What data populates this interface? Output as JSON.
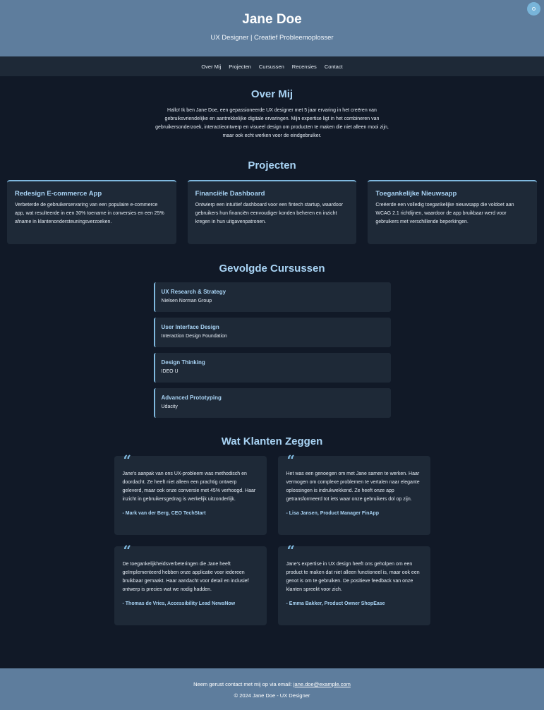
{
  "header": {
    "name": "Jane Doe",
    "tagline": "UX Designer | Creatief Probleemoplosser"
  },
  "nav": {
    "items": [
      "Over Mij",
      "Projecten",
      "Cursussen",
      "Recensies",
      "Contact"
    ]
  },
  "about": {
    "title": "Over Mij",
    "text": "Hallo! Ik ben Jane Doe, een gepassioneerde UX designer met 5 jaar ervaring in het creëren van gebruiksvriendelijke en aantrekkelijke digitale ervaringen. Mijn expertise ligt in het combineren van gebruikersonderzoek, interactieontwerp en visueel design om producten te maken die niet alleen mooi zijn, maar ook echt werken voor de eindgebruiker."
  },
  "projects": {
    "title": "Projecten",
    "items": [
      {
        "title": "Redesign E-commerce App",
        "text": "Verbeterde de gebruikerservaring van een populaire e-commerce app, wat resulteerde in een 30% toename in conversies en een 25% afname in klantenondersteuningsverzoeken."
      },
      {
        "title": "Financiële Dashboard",
        "text": "Ontwierp een intuïtief dashboard voor een fintech startup, waardoor gebruikers hun financiën eenvoudiger konden beheren en inzicht kregen in hun uitgavenpatronen."
      },
      {
        "title": "Toegankelijke Nieuwsapp",
        "text": "Creëerde een volledig toegankelijke nieuwsapp die voldoet aan WCAG 2.1 richtlijnen, waardoor de app bruikbaar werd voor gebruikers met verschillende beperkingen."
      }
    ]
  },
  "courses": {
    "title": "Gevolgde Cursussen",
    "items": [
      {
        "title": "UX Research & Strategy",
        "provider": "Nielsen Norman Group"
      },
      {
        "title": "User Interface Design",
        "provider": "Interaction Design Foundation"
      },
      {
        "title": "Design Thinking",
        "provider": "IDEO U"
      },
      {
        "title": "Advanced Prototyping",
        "provider": "Udacity"
      }
    ]
  },
  "reviews": {
    "title": "Wat Klanten Zeggen",
    "quote_glyph": "“",
    "items": [
      {
        "text": "Jane's aanpak van ons UX-probleem was methodisch en doordacht. Ze heeft niet alleen een prachtig ontwerp geleverd, maar ook onze conversie met 45% verhoogd. Haar inzicht in gebruikersgedrag is werkelijk uitzonderlijk.",
        "author": "- Mark van der Berg, CEO TechStart"
      },
      {
        "text": "Het was een genoegen om met Jane samen te werken. Haar vermogen om complexe problemen te vertalen naar elegante oplossingen is indrukwekkend. Ze heeft onze app getransformeerd tot iets waar onze gebruikers dol op zijn.",
        "author": "- Lisa Jansen, Product Manager FinApp"
      },
      {
        "text": "De toegankelijkheidsverbeteringen die Jane heeft geïmplementeerd hebben onze applicatie voor iedereen bruikbaar gemaakt. Haar aandacht voor detail en inclusief ontwerp is precies wat we nodig hadden.",
        "author": "- Thomas de Vries, Accessibility Lead NewsNow"
      },
      {
        "text": "Jane's expertise in UX design heeft ons geholpen om een product te maken dat niet alleen functioneel is, maar ook een genot is om te gebruiken. De positieve feedback van onze klanten spreekt voor zich.",
        "author": "- Emma Bakker, Product Owner ShopEase"
      }
    ]
  },
  "footer": {
    "contact_text": "Neem gerust contact met mij op via email: ",
    "email": "jane.doe@example.com",
    "copyright": "© 2024 Jane Doe - UX Designer"
  },
  "colors": {
    "header_bg": "#5e7d9d",
    "page_bg": "#111927",
    "card_bg": "#1e2937",
    "accent": "#a9d4f5",
    "toggle": "#78b4d9"
  },
  "icons": {
    "theme_toggle": "theme-toggle-icon",
    "quote": "quote-icon"
  }
}
